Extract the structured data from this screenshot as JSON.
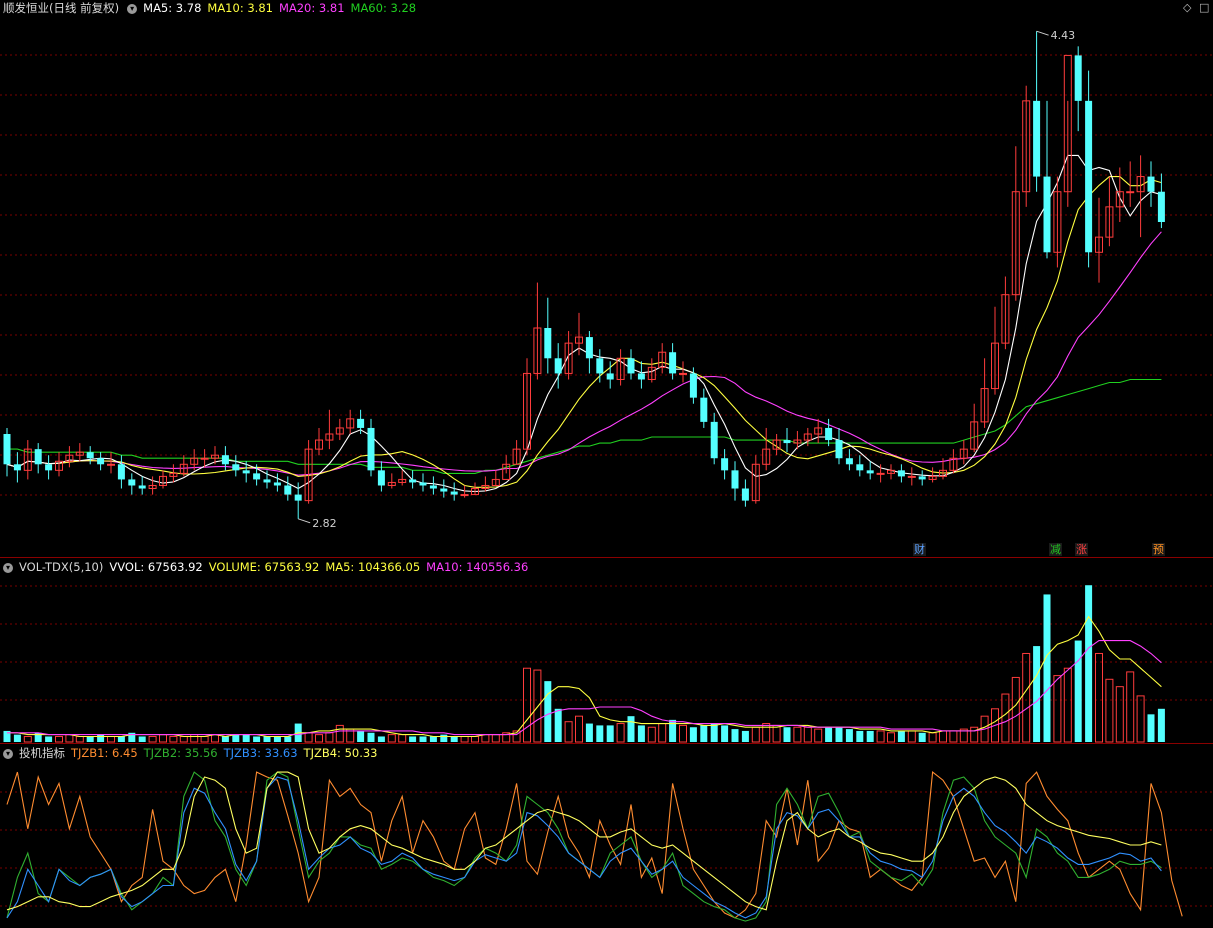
{
  "header": {
    "stock": "顺发恒业(日线 前复权)",
    "ma5": "MA5: 3.78",
    "ma10": "MA10: 3.81",
    "ma20": "MA20: 3.81",
    "ma60": "MA60: 3.28",
    "vol_name": "VOL-TDX(5,10)",
    "vvol": "VVOL: 67563.92",
    "volume": "VOLUME: 67563.92",
    "vma5": "MA5: 104366.05",
    "vma10": "MA10: 140556.36",
    "ind_name": "投机指标",
    "tj1": "TJZB1: 6.45",
    "tj2": "TJZB2: 35.56",
    "tj3": "TJZB3: 33.63",
    "tj4": "TJZB4: 50.33"
  },
  "annotations": {
    "high": "4.43",
    "low": "2.82"
  },
  "tags": [
    {
      "text": "财",
      "color": "#5aa0ff"
    },
    {
      "text": "减",
      "color": "#22c422"
    },
    {
      "text": "涨",
      "color": "#ff4040"
    },
    {
      "text": "预",
      "color": "#ff9020"
    }
  ],
  "colors": {
    "up": "#ff3c3c",
    "down": "#54ffff",
    "ma5": "#ffffff",
    "ma10": "#ffff40",
    "ma20": "#ff40ff",
    "ma60": "#20d020",
    "tj1": "#ff8c30",
    "tj2": "#30b030",
    "tj3": "#3090ff",
    "tj4": "#ffff60",
    "grid": "#7a0000"
  },
  "chart_data": {
    "type": "candlestick",
    "price": {
      "open": [
        3.1,
        3.0,
        2.98,
        3.05,
        3.0,
        2.98,
        3.01,
        3.03,
        3.04,
        3.02,
        3.0,
        3.0,
        2.95,
        2.93,
        2.92,
        2.93,
        2.96,
        2.97,
        3.0,
        3.02,
        3.02,
        3.03,
        3.0,
        2.98,
        2.97,
        2.95,
        2.94,
        2.93,
        2.9,
        2.88,
        3.05,
        3.08,
        3.1,
        3.12,
        3.15,
        3.12,
        2.98,
        2.93,
        2.94,
        2.95,
        2.94,
        2.93,
        2.92,
        2.91,
        2.9,
        2.9,
        2.92,
        2.93,
        2.95,
        3.0,
        3.05,
        3.3,
        3.45,
        3.35,
        3.3,
        3.4,
        3.42,
        3.35,
        3.3,
        3.28,
        3.35,
        3.3,
        3.28,
        3.32,
        3.37,
        3.3,
        3.3,
        3.22,
        3.14,
        3.02,
        2.98,
        2.92,
        2.88,
        3.0,
        3.05,
        3.08,
        3.07,
        3.08,
        3.1,
        3.12,
        3.08,
        3.02,
        3.0,
        2.98,
        2.97,
        2.97,
        2.98,
        2.96,
        2.96,
        2.95,
        2.96,
        2.98,
        3.02,
        3.05,
        3.14,
        3.25,
        3.4,
        3.56,
        3.9,
        4.2,
        3.95,
        3.7,
        3.9,
        4.35,
        4.2,
        3.7,
        3.75,
        3.85,
        3.9,
        3.9,
        3.95,
        3.9
      ],
      "close": [
        3.0,
        2.98,
        3.05,
        3.0,
        2.98,
        3.01,
        3.03,
        3.04,
        3.02,
        3.0,
        3.0,
        2.95,
        2.93,
        2.92,
        2.93,
        2.96,
        2.97,
        3.0,
        3.02,
        3.02,
        3.03,
        3.0,
        2.98,
        2.97,
        2.95,
        2.94,
        2.93,
        2.9,
        2.88,
        3.05,
        3.08,
        3.1,
        3.12,
        3.15,
        3.12,
        2.98,
        2.93,
        2.94,
        2.95,
        2.94,
        2.93,
        2.92,
        2.91,
        2.9,
        2.9,
        2.92,
        2.93,
        2.95,
        3.0,
        3.05,
        3.3,
        3.45,
        3.35,
        3.3,
        3.4,
        3.42,
        3.35,
        3.3,
        3.28,
        3.35,
        3.3,
        3.28,
        3.32,
        3.37,
        3.3,
        3.3,
        3.22,
        3.14,
        3.02,
        2.98,
        2.92,
        2.88,
        3.0,
        3.05,
        3.08,
        3.07,
        3.08,
        3.1,
        3.12,
        3.08,
        3.02,
        3.0,
        2.98,
        2.97,
        2.97,
        2.98,
        2.96,
        2.96,
        2.95,
        2.96,
        2.98,
        3.02,
        3.05,
        3.14,
        3.25,
        3.4,
        3.56,
        3.9,
        4.2,
        3.95,
        3.7,
        3.9,
        4.35,
        4.2,
        3.7,
        3.75,
        3.85,
        3.9,
        3.9,
        3.95,
        3.9,
        3.8
      ],
      "high": [
        3.12,
        3.04,
        3.08,
        3.07,
        3.03,
        3.04,
        3.06,
        3.07,
        3.06,
        3.04,
        3.04,
        3.03,
        2.97,
        2.96,
        2.96,
        2.98,
        3.0,
        3.03,
        3.05,
        3.05,
        3.06,
        3.06,
        3.03,
        3.01,
        3.0,
        2.98,
        2.97,
        2.96,
        2.94,
        3.08,
        3.12,
        3.18,
        3.15,
        3.18,
        3.18,
        3.15,
        3.01,
        2.97,
        2.98,
        2.98,
        2.97,
        2.96,
        2.95,
        2.94,
        2.93,
        2.94,
        2.96,
        2.98,
        3.03,
        3.08,
        3.35,
        3.6,
        3.55,
        3.4,
        3.44,
        3.5,
        3.44,
        3.38,
        3.34,
        3.38,
        3.38,
        3.34,
        3.35,
        3.4,
        3.4,
        3.34,
        3.32,
        3.25,
        3.17,
        3.05,
        3.01,
        2.95,
        3.03,
        3.12,
        3.1,
        3.12,
        3.11,
        3.12,
        3.15,
        3.15,
        3.12,
        3.05,
        3.03,
        3.01,
        3.0,
        3.0,
        3.0,
        2.99,
        2.98,
        2.99,
        3.02,
        3.05,
        3.08,
        3.2,
        3.35,
        3.52,
        3.62,
        4.05,
        4.25,
        4.43,
        4.2,
        3.95,
        4.2,
        4.38,
        4.3,
        3.88,
        3.95,
        3.98,
        4.0,
        4.02,
        4.0,
        3.96
      ],
      "low": [
        2.96,
        2.94,
        2.95,
        2.97,
        2.95,
        2.96,
        2.99,
        3.01,
        3.0,
        2.98,
        2.97,
        2.92,
        2.9,
        2.9,
        2.9,
        2.92,
        2.94,
        2.96,
        2.98,
        2.99,
        3.0,
        2.98,
        2.96,
        2.94,
        2.93,
        2.92,
        2.91,
        2.88,
        2.82,
        2.87,
        3.03,
        3.05,
        3.08,
        3.1,
        3.1,
        2.96,
        2.91,
        2.92,
        2.93,
        2.92,
        2.91,
        2.9,
        2.89,
        2.88,
        2.89,
        2.9,
        2.91,
        2.93,
        2.97,
        3.0,
        3.03,
        3.28,
        3.3,
        3.25,
        3.28,
        3.36,
        3.3,
        3.27,
        3.25,
        3.26,
        3.28,
        3.25,
        3.27,
        3.3,
        3.28,
        3.27,
        3.2,
        3.12,
        3.0,
        2.95,
        2.88,
        2.86,
        2.87,
        2.98,
        3.03,
        3.04,
        3.05,
        3.06,
        3.07,
        3.06,
        3.0,
        2.98,
        2.96,
        2.95,
        2.94,
        2.95,
        2.94,
        2.93,
        2.93,
        2.94,
        2.95,
        2.97,
        3.0,
        3.04,
        3.12,
        3.23,
        3.38,
        3.54,
        3.85,
        3.9,
        3.68,
        3.65,
        3.85,
        4.1,
        3.65,
        3.6,
        3.72,
        3.8,
        3.85,
        3.75,
        3.85,
        3.78
      ]
    },
    "ma60": [
      3.05,
      3.05,
      3.04,
      3.04,
      3.04,
      3.04,
      3.04,
      3.04,
      3.04,
      3.04,
      3.04,
      3.03,
      3.03,
      3.02,
      3.02,
      3.02,
      3.02,
      3.02,
      3.02,
      3.02,
      3.02,
      3.02,
      3.01,
      3.01,
      3.01,
      3.01,
      3.01,
      3.01,
      3.0,
      3.0,
      3.0,
      3.0,
      3.0,
      3.0,
      3.0,
      2.99,
      2.99,
      2.99,
      2.99,
      2.98,
      2.98,
      2.98,
      2.97,
      2.97,
      2.97,
      2.97,
      2.98,
      2.98,
      2.99,
      3.0,
      3.01,
      3.02,
      3.03,
      3.04,
      3.05,
      3.06,
      3.06,
      3.07,
      3.07,
      3.08,
      3.08,
      3.08,
      3.09,
      3.09,
      3.09,
      3.09,
      3.09,
      3.09,
      3.09,
      3.09,
      3.08,
      3.08,
      3.08,
      3.08,
      3.08,
      3.08,
      3.07,
      3.07,
      3.07,
      3.07,
      3.07,
      3.07,
      3.07,
      3.07,
      3.07,
      3.07,
      3.07,
      3.07,
      3.07,
      3.07,
      3.07,
      3.07,
      3.08,
      3.09,
      3.1,
      3.11,
      3.13,
      3.16,
      3.19,
      3.2,
      3.21,
      3.22,
      3.23,
      3.24,
      3.25,
      3.26,
      3.27,
      3.27,
      3.28,
      3.28,
      3.28,
      3.28
    ],
    "volume": {
      "values": [
        6,
        4,
        3,
        5,
        3,
        3,
        4,
        3,
        3,
        4,
        3,
        3,
        5,
        3,
        3,
        4,
        3,
        3,
        4,
        3,
        4,
        3,
        4,
        4,
        3,
        3,
        3,
        3,
        10,
        5,
        4,
        5,
        9,
        7,
        6,
        5,
        3,
        4,
        4,
        3,
        3,
        3,
        4,
        3,
        3,
        3,
        4,
        4,
        5,
        6,
        40,
        39,
        33,
        18,
        11,
        14,
        10,
        9,
        9,
        10,
        14,
        9,
        8,
        10,
        12,
        9,
        8,
        9,
        10,
        9,
        7,
        6,
        8,
        10,
        9,
        8,
        8,
        8,
        7,
        8,
        8,
        7,
        6,
        6,
        6,
        5,
        6,
        6,
        5,
        5,
        6,
        6,
        7,
        8,
        14,
        18,
        26,
        35,
        48,
        52,
        80,
        36,
        40,
        55,
        85,
        48,
        34,
        30,
        38,
        25,
        15,
        18
      ],
      "ma5": [
        5,
        5,
        4,
        4,
        4,
        4,
        4,
        3,
        3,
        3,
        3,
        3,
        4,
        4,
        4,
        4,
        4,
        3,
        3,
        3,
        4,
        3,
        4,
        4,
        4,
        3,
        3,
        3,
        5,
        5,
        6,
        6,
        7,
        7,
        7,
        7,
        6,
        5,
        4,
        4,
        4,
        3,
        3,
        3,
        3,
        3,
        4,
        4,
        4,
        5,
        12,
        19,
        26,
        30,
        30,
        29,
        24,
        14,
        12,
        11,
        11,
        10,
        10,
        10,
        10,
        10,
        10,
        9,
        9,
        10,
        9,
        8,
        8,
        8,
        8,
        9,
        9,
        9,
        8,
        8,
        8,
        8,
        7,
        7,
        7,
        6,
        6,
        6,
        6,
        5,
        6,
        6,
        6,
        6,
        8,
        11,
        15,
        20,
        28,
        36,
        47,
        53,
        55,
        58,
        68,
        60,
        50,
        45,
        45,
        40,
        35,
        30
      ],
      "ma10": [
        5,
        5,
        5,
        5,
        4,
        4,
        4,
        4,
        4,
        4,
        4,
        4,
        4,
        4,
        4,
        4,
        4,
        4,
        4,
        4,
        4,
        4,
        4,
        4,
        4,
        4,
        4,
        4,
        4,
        5,
        5,
        5,
        6,
        6,
        6,
        6,
        6,
        6,
        6,
        6,
        5,
        5,
        5,
        4,
        4,
        4,
        4,
        4,
        4,
        4,
        8,
        12,
        15,
        17,
        18,
        18,
        18,
        19,
        19,
        19,
        19,
        17,
        14,
        12,
        11,
        11,
        10,
        10,
        10,
        10,
        10,
        9,
        9,
        9,
        9,
        9,
        9,
        8,
        8,
        8,
        8,
        8,
        8,
        8,
        8,
        7,
        7,
        7,
        7,
        7,
        6,
        6,
        6,
        6,
        7,
        9,
        11,
        14,
        18,
        22,
        28,
        34,
        39,
        44,
        51,
        55,
        55,
        55,
        55,
        52,
        48,
        43
      ]
    },
    "indicator": {
      "ylim": [
        0,
        100
      ],
      "TJZB1": [
        75,
        95,
        60,
        92,
        75,
        88,
        60,
        80,
        55,
        45,
        35,
        15,
        25,
        30,
        72,
        40,
        35,
        25,
        20,
        22,
        30,
        35,
        15,
        50,
        95,
        92,
        90,
        68,
        45,
        15,
        30,
        90,
        80,
        85,
        75,
        70,
        40,
        65,
        80,
        45,
        65,
        55,
        40,
        35,
        60,
        70,
        42,
        38,
        60,
        88,
        40,
        32,
        58,
        80,
        55,
        45,
        30,
        65,
        50,
        38,
        75,
        30,
        42,
        20,
        88,
        60,
        35,
        25,
        15,
        8,
        5,
        10,
        20,
        65,
        55,
        85,
        50,
        90,
        40,
        48,
        65,
        60,
        58,
        30,
        35,
        30,
        25,
        22,
        30,
        95,
        90,
        80,
        60,
        40,
        42,
        30,
        40,
        15,
        88,
        95,
        80,
        72,
        65,
        45,
        30,
        35,
        40,
        35,
        20,
        10,
        88,
        70,
        28,
        6
      ],
      "TJZB2": [
        5,
        30,
        45,
        20,
        15,
        35,
        30,
        25,
        30,
        32,
        35,
        20,
        10,
        15,
        20,
        30,
        25,
        80,
        95,
        90,
        65,
        55,
        35,
        25,
        40,
        90,
        95,
        92,
        60,
        30,
        40,
        45,
        55,
        55,
        50,
        48,
        35,
        38,
        42,
        40,
        35,
        30,
        28,
        25,
        30,
        42,
        48,
        45,
        40,
        50,
        80,
        75,
        70,
        60,
        45,
        40,
        35,
        30,
        45,
        50,
        55,
        40,
        30,
        35,
        45,
        25,
        20,
        15,
        12,
        10,
        5,
        3,
        5,
        15,
        75,
        85,
        75,
        60,
        80,
        82,
        70,
        55,
        58,
        40,
        35,
        30,
        28,
        32,
        25,
        35,
        70,
        90,
        92,
        85,
        65,
        55,
        50,
        45,
        30,
        60,
        55,
        45,
        40,
        30,
        30,
        32,
        35,
        40,
        38,
        38,
        40,
        36
      ],
      "TJZB3": [
        5,
        15,
        35,
        25,
        15,
        35,
        28,
        25,
        30,
        32,
        35,
        18,
        12,
        15,
        20,
        25,
        25,
        70,
        85,
        82,
        70,
        60,
        38,
        28,
        40,
        85,
        92,
        90,
        65,
        35,
        42,
        48,
        50,
        55,
        48,
        45,
        38,
        40,
        45,
        42,
        35,
        32,
        30,
        28,
        30,
        40,
        44,
        42,
        40,
        45,
        70,
        68,
        62,
        55,
        45,
        40,
        35,
        30,
        40,
        45,
        48,
        40,
        32,
        35,
        40,
        30,
        25,
        20,
        15,
        12,
        8,
        5,
        8,
        18,
        60,
        70,
        68,
        60,
        70,
        72,
        65,
        55,
        55,
        45,
        40,
        38,
        35,
        34,
        30,
        40,
        65,
        80,
        85,
        80,
        70,
        62,
        58,
        52,
        45,
        55,
        52,
        48,
        42,
        38,
        38,
        40,
        42,
        45,
        44,
        40,
        42,
        34
      ],
      "TJZB4": [
        10,
        12,
        15,
        18,
        18,
        15,
        14,
        12,
        12,
        15,
        18,
        20,
        22,
        25,
        30,
        35,
        35,
        50,
        80,
        92,
        90,
        85,
        60,
        45,
        48,
        85,
        95,
        95,
        92,
        60,
        45,
        48,
        55,
        60,
        62,
        60,
        55,
        50,
        48,
        45,
        42,
        40,
        38,
        35,
        35,
        40,
        48,
        50,
        55,
        60,
        65,
        70,
        72,
        70,
        68,
        65,
        60,
        55,
        55,
        58,
        60,
        55,
        50,
        48,
        50,
        45,
        40,
        35,
        30,
        25,
        20,
        15,
        12,
        10,
        40,
        65,
        70,
        60,
        55,
        58,
        60,
        55,
        52,
        48,
        45,
        44,
        42,
        40,
        40,
        45,
        55,
        70,
        80,
        85,
        90,
        92,
        90,
        85,
        75,
        70,
        65,
        62,
        60,
        58,
        56,
        55,
        54,
        52,
        50,
        50,
        52,
        50
      ]
    }
  }
}
